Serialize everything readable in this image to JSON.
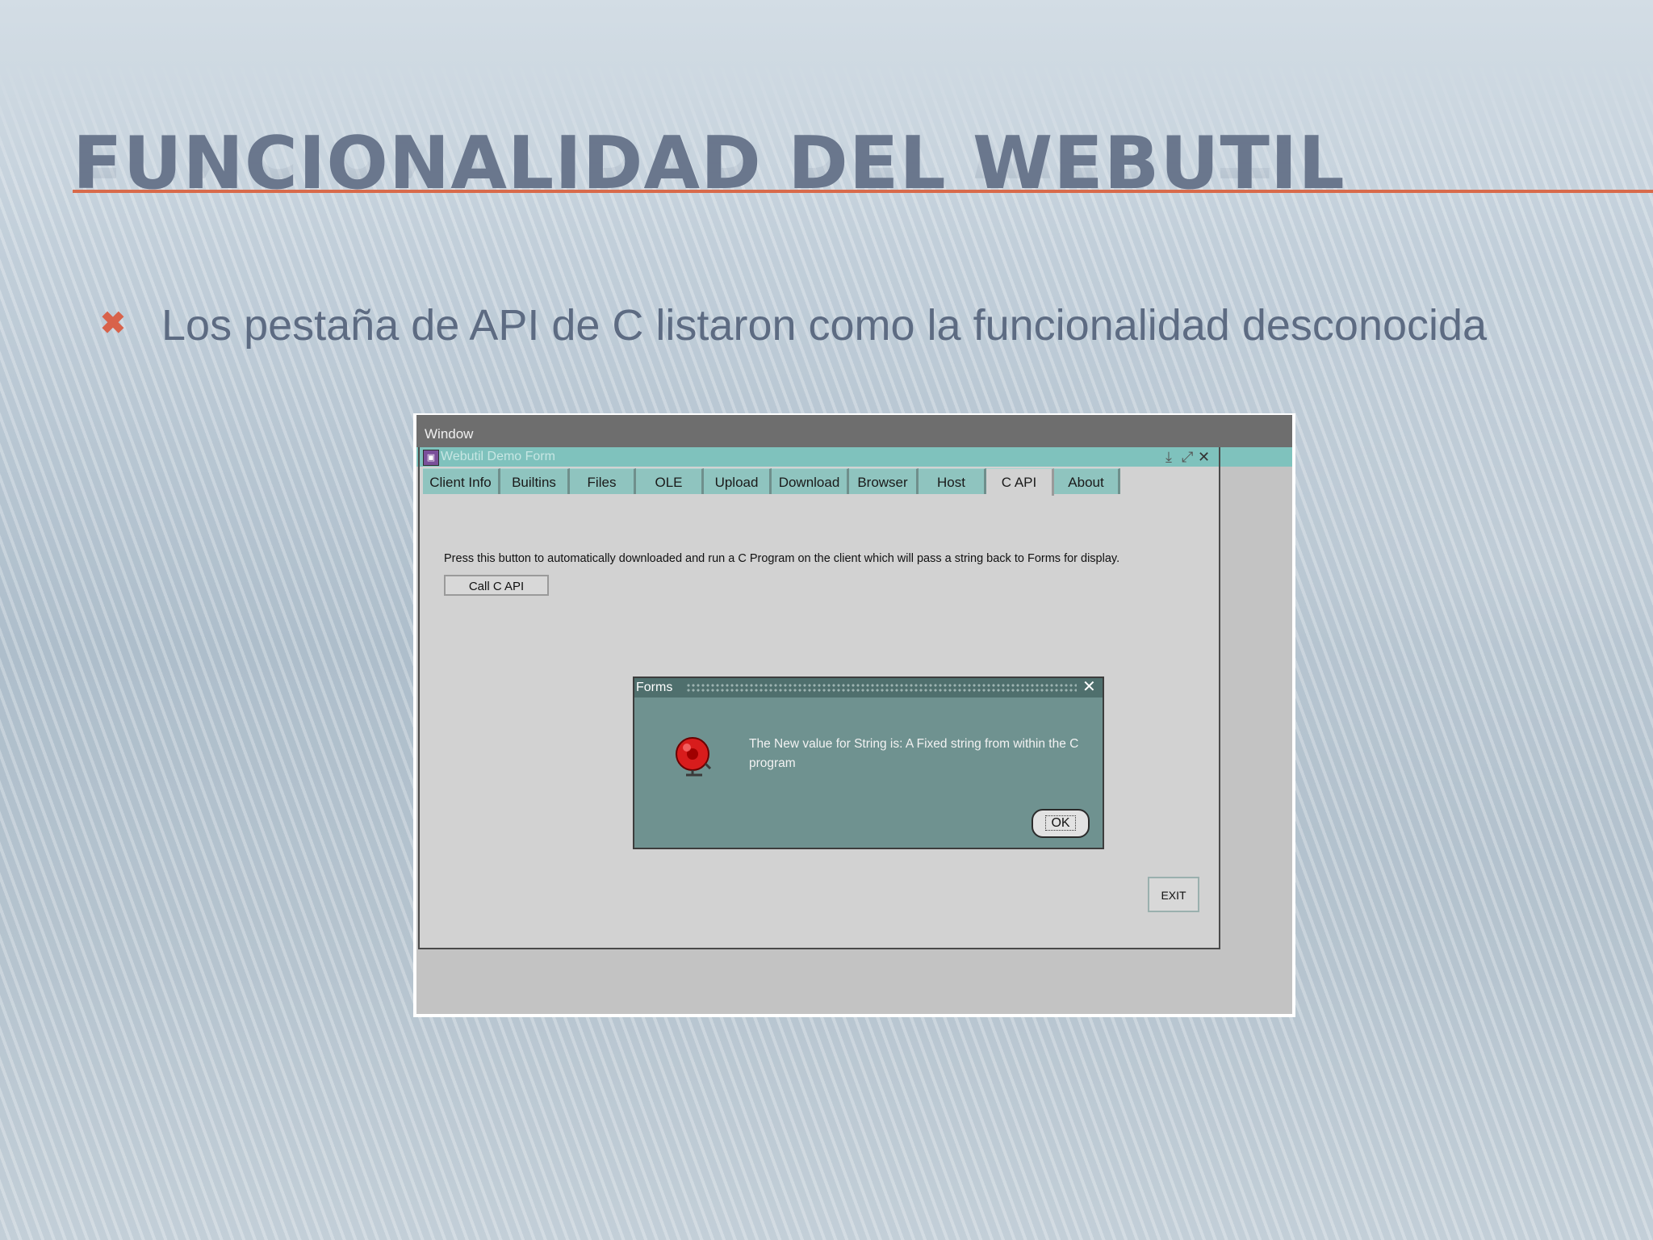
{
  "slide": {
    "title": "FUNCIONALIDAD DEL WEBUTIL",
    "bullet_icon": "x-mark",
    "bullet_text": "Los pestaña de API de C listaron como la funcionalidad desconocida"
  },
  "screenshot": {
    "menu_window": "Window",
    "form_title": "Webutil Demo Form",
    "window_controls": [
      "minimize-icon",
      "restore-icon",
      "close-icon"
    ],
    "tabs": [
      {
        "label": "Client Info",
        "active": false
      },
      {
        "label": "Builtins",
        "active": false
      },
      {
        "label": "Files",
        "active": false
      },
      {
        "label": "OLE",
        "active": false
      },
      {
        "label": "Upload",
        "active": false
      },
      {
        "label": "Download",
        "active": false
      },
      {
        "label": "Browser",
        "active": false
      },
      {
        "label": "Host",
        "active": false
      },
      {
        "label": "C API",
        "active": true
      },
      {
        "label": "About",
        "active": false
      }
    ],
    "prompt_text": "Press this button to automatically downloaded and run a C Program on the client which will pass a string back to Forms for display.",
    "call_button": "Call C API",
    "exit_button": "EXIT",
    "dialog": {
      "title": "Forms",
      "icon": "alarm-bell-icon",
      "message": "The New value for String is: A Fixed string from within the C program",
      "ok_button": "OK"
    }
  },
  "colors": {
    "title": "#6a778d",
    "accent_rule": "#d86a4a",
    "bullet_x": "#d8624a",
    "tab_bar": "#8fc4bf",
    "dialog_bg": "#6f9290"
  }
}
